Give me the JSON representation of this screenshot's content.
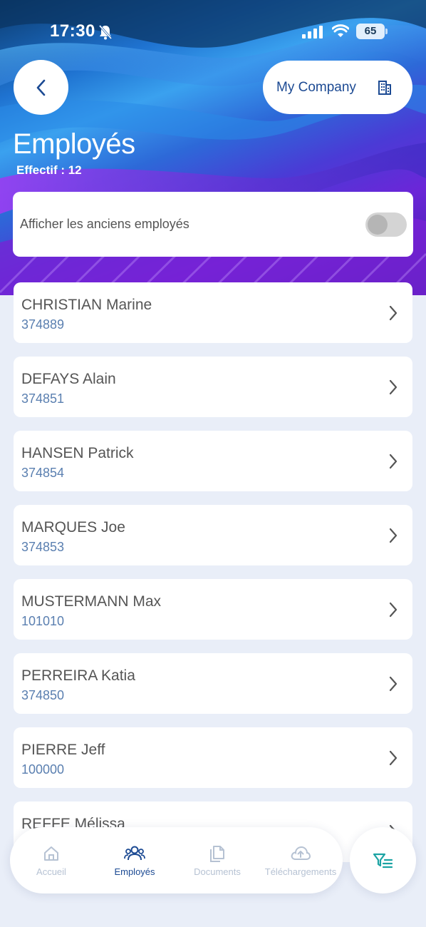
{
  "status_bar": {
    "time": "17:30",
    "battery": "65"
  },
  "header": {
    "company_label": "My Company",
    "title": "Employés",
    "effectif": "Effectif : 12"
  },
  "toggle": {
    "label": "Afficher les anciens employés",
    "on": false
  },
  "employees": [
    {
      "name": "CHRISTIAN Marine",
      "number": "374889"
    },
    {
      "name": "DEFAYS Alain",
      "number": "374851"
    },
    {
      "name": "HANSEN Patrick",
      "number": "374854"
    },
    {
      "name": "MARQUES Joe",
      "number": "374853"
    },
    {
      "name": "MUSTERMANN Max",
      "number": "101010"
    },
    {
      "name": "PERREIRA Katia",
      "number": "374850"
    },
    {
      "name": "PIERRE Jeff",
      "number": "100000"
    },
    {
      "name": "REFFE Mélissa",
      "number": ""
    }
  ],
  "tabs": [
    {
      "label": "Accueil",
      "icon": "home-icon"
    },
    {
      "label": "Employés",
      "icon": "people-icon",
      "active": true
    },
    {
      "label": "Documents",
      "icon": "documents-icon"
    },
    {
      "label": "Téléchargements",
      "icon": "cloud-upload-icon"
    }
  ],
  "colors": {
    "accent": "#1c4a93",
    "number": "#5a7fb0",
    "filter": "#1ba3a3"
  }
}
